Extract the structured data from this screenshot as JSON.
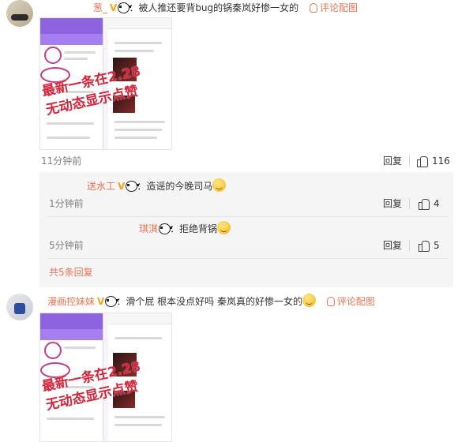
{
  "comments": [
    {
      "user": "葱_",
      "badge": "V",
      "text": "：被人推还要背bug的锅秦岚好惨一女的",
      "link": "评论配图",
      "time": "11分钟前",
      "reply_label": "回复",
      "likes": "116",
      "image_overlay": [
        "最新一条在2.28",
        "无动态显示点赞"
      ]
    },
    {
      "user": "漫画控妹妹",
      "badge": "V",
      "text": "：滑个屁 根本没点好吗 秦岚真的好惨一女的",
      "link": "评论配图",
      "image_overlay": [
        "最新一条在2.28",
        "无动态显示点赞"
      ]
    }
  ],
  "replies": [
    {
      "user": "送水工",
      "text": "：造谣的今晚司马",
      "time": "1分钟前",
      "reply_label": "回复",
      "likes": "4"
    },
    {
      "user": "琪淇",
      "text": "：拒绝背锅",
      "time": "5分钟前",
      "reply_label": "回复",
      "likes": "5"
    }
  ],
  "more_replies": "共5条回复",
  "icons": {
    "panda": "panda-emoji-icon",
    "smile": "smile-emoji-icon",
    "like": "thumb-up-icon",
    "picture": "image-icon"
  },
  "colors": {
    "accent": "#eb7350",
    "meta": "#808080",
    "reply_bg": "#f5f5f5"
  }
}
